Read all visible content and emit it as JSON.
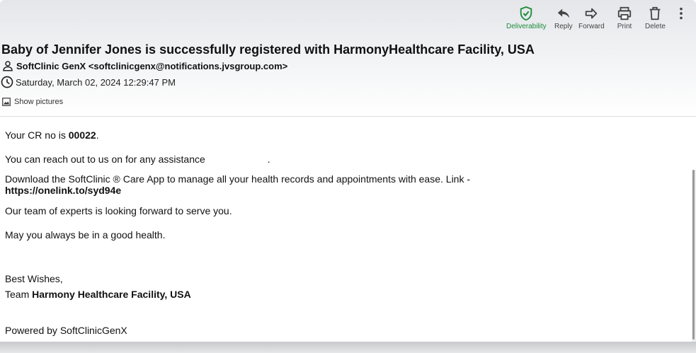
{
  "toolbar": {
    "deliverability": "Deliverability",
    "reply": "Reply",
    "forward": "Forward",
    "print": "Print",
    "delete": "Delete"
  },
  "email": {
    "subject": "Baby of Jennifer Jones is successfully registered with HarmonyHealthcare Facility, USA",
    "from": "SoftClinic GenX <softclinicgenx@notifications.jvsgroup.com>",
    "date": "Saturday, March 02, 2024 12:29:47 PM",
    "show_pictures": "Show pictures"
  },
  "body": {
    "cr_prefix": "Your CR no is ",
    "cr_number": "00022",
    "cr_suffix": ".",
    "reach_out": "You can reach out to us on  for any assistance",
    "reach_out_dot": ".",
    "download": "Download the SoftClinic ® Care App to manage all your health records and appointments with ease. Link -",
    "link": "https://onelink.to/syd94e",
    "team_line": "Our team of experts is looking forward to serve you.",
    "health_line": "May you always be in a good health.",
    "wishes": "Best Wishes,",
    "team_prefix": "Team ",
    "team_name": "Harmony Healthcare Facility, USA",
    "powered": "Powered by SoftClinicGenX"
  },
  "colors": {
    "deliverability": "#1c8c3a",
    "toolbar_icon": "#444444"
  }
}
